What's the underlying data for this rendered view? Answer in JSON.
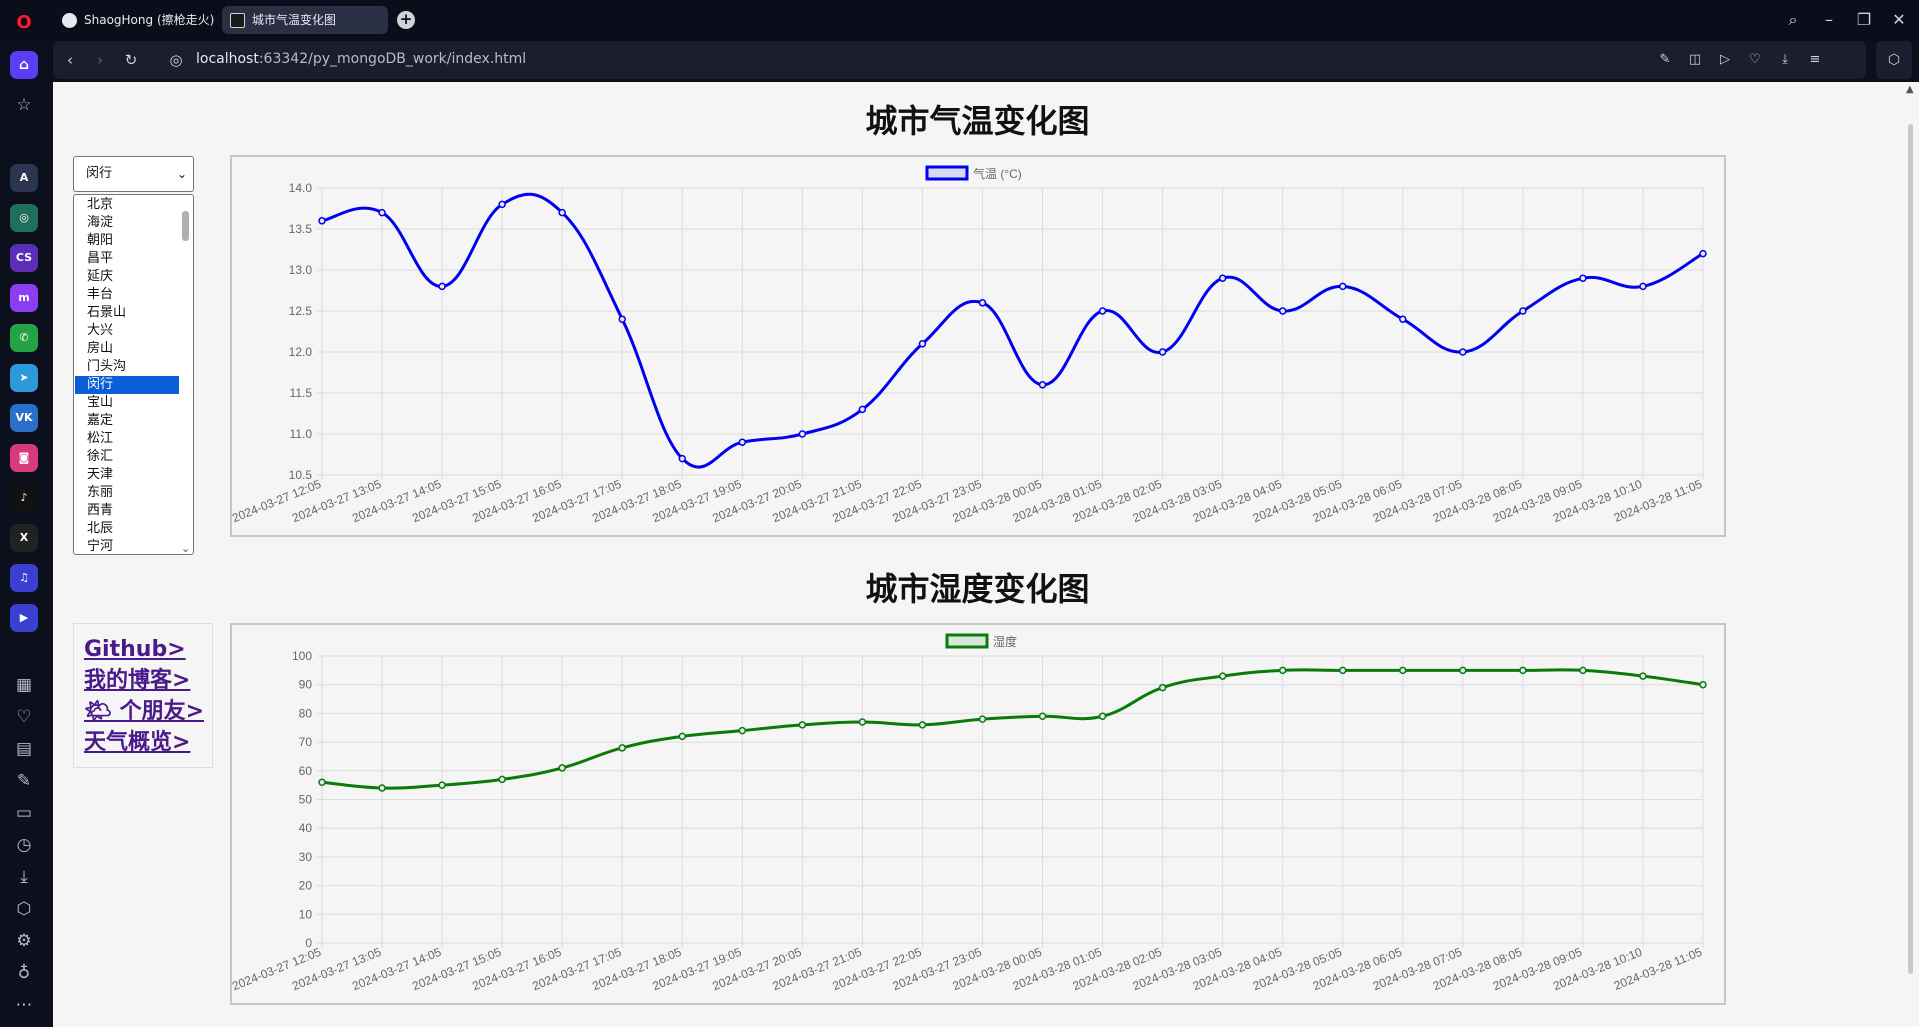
{
  "browser": {
    "tabs": [
      {
        "label": "ShaogHong (擦枪走火)"
      },
      {
        "label": "城市气温变化图"
      }
    ],
    "url_host": "localhost",
    "url_rest": ":63342/py_mongoDB_work/index.html"
  },
  "page": {
    "temp_title": "城市气温变化图",
    "humidity_title": "城市湿度变化图",
    "select_value": "闵行",
    "cities": [
      "北京",
      "海淀",
      "朝阳",
      "昌平",
      "延庆",
      "丰台",
      "石景山",
      "大兴",
      "房山",
      "门头沟",
      "闵行",
      "宝山",
      "嘉定",
      "松江",
      "徐汇",
      "天津",
      "东丽",
      "西青",
      "北辰",
      "宁河"
    ],
    "selected_city": "闵行",
    "links": [
      "Github>",
      "我的博客>",
      "🌤 个朋友>",
      "天气概览>"
    ]
  },
  "chart_data": [
    {
      "type": "line",
      "legend": "气温 (°C)",
      "color": "#0000ee",
      "x": [
        "2024-03-27 12:05",
        "2024-03-27 13:05",
        "2024-03-27 14:05",
        "2024-03-27 15:05",
        "2024-03-27 16:05",
        "2024-03-27 17:05",
        "2024-03-27 18:05",
        "2024-03-27 19:05",
        "2024-03-27 20:05",
        "2024-03-27 21:05",
        "2024-03-27 22:05",
        "2024-03-27 23:05",
        "2024-03-28 00:05",
        "2024-03-28 01:05",
        "2024-03-28 02:05",
        "2024-03-28 03:05",
        "2024-03-28 04:05",
        "2024-03-28 05:05",
        "2024-03-28 06:05",
        "2024-03-28 07:05",
        "2024-03-28 08:05",
        "2024-03-28 09:05",
        "2024-03-28 10:10",
        "2024-03-28 11:05"
      ],
      "values": [
        13.6,
        13.7,
        12.8,
        13.8,
        13.7,
        12.4,
        10.7,
        10.9,
        11.0,
        11.3,
        12.1,
        12.6,
        11.6,
        12.5,
        12.0,
        12.9,
        12.5,
        12.8,
        12.4,
        12.0,
        12.5,
        12.9,
        12.8,
        13.2
      ],
      "ylim": [
        10.5,
        14.0
      ],
      "yticks": [
        "14.0",
        "13.5",
        "13.0",
        "12.5",
        "12.0",
        "11.5",
        "11.0",
        "10.5"
      ],
      "grid": true,
      "legend_position": "top"
    },
    {
      "type": "line",
      "legend": "湿度",
      "color": "#0a7a0a",
      "x": [
        "2024-03-27 12:05",
        "2024-03-27 13:05",
        "2024-03-27 14:05",
        "2024-03-27 15:05",
        "2024-03-27 16:05",
        "2024-03-27 17:05",
        "2024-03-27 18:05",
        "2024-03-27 19:05",
        "2024-03-27 20:05",
        "2024-03-27 21:05",
        "2024-03-27 22:05",
        "2024-03-27 23:05",
        "2024-03-28 00:05",
        "2024-03-28 01:05",
        "2024-03-28 02:05",
        "2024-03-28 03:05",
        "2024-03-28 04:05",
        "2024-03-28 05:05",
        "2024-03-28 06:05",
        "2024-03-28 07:05",
        "2024-03-28 08:05",
        "2024-03-28 09:05",
        "2024-03-28 10:10",
        "2024-03-28 11:05"
      ],
      "values": [
        56,
        54,
        55,
        57,
        61,
        68,
        72,
        74,
        76,
        77,
        76,
        78,
        79,
        79,
        89,
        93,
        95,
        95,
        95,
        95,
        95,
        95,
        93,
        90
      ],
      "ylim": [
        0,
        100
      ],
      "yticks": [
        "100",
        "90",
        "80",
        "70",
        "60",
        "50",
        "40",
        "30",
        "20",
        "10",
        "0"
      ],
      "grid": true,
      "legend_position": "top"
    }
  ]
}
